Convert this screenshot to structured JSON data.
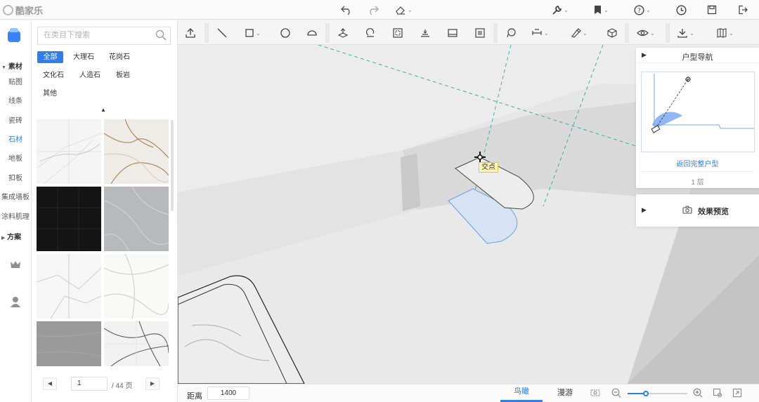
{
  "app": {
    "name": "酷家乐"
  },
  "rail": {
    "groups": {
      "materials": "素材",
      "solutions": "方案"
    },
    "items": [
      {
        "label": "贴图",
        "active": false
      },
      {
        "label": "线条",
        "active": false
      },
      {
        "label": "瓷砖",
        "active": false
      },
      {
        "label": "石材",
        "active": true
      },
      {
        "label": "地板",
        "active": false
      },
      {
        "label": "扣板",
        "active": false
      },
      {
        "label": "集成墙板",
        "active": false
      },
      {
        "label": "涂料肌理",
        "active": false
      }
    ],
    "icons": [
      "home-icon",
      "crown-icon",
      "user-icon"
    ]
  },
  "panel": {
    "search_placeholder": "在类目下搜索",
    "chips": [
      {
        "label": "全部",
        "active": true
      },
      {
        "label": "大理石",
        "active": false
      },
      {
        "label": "花岗石",
        "active": false
      },
      {
        "label": "文化石",
        "active": false
      },
      {
        "label": "人造石",
        "active": false
      },
      {
        "label": "板岩",
        "active": false
      },
      {
        "label": "其他",
        "active": false
      }
    ],
    "thumbnails": [
      "white-marble-grey-veins",
      "beige-marble-gold-veins",
      "black-marble",
      "grey-marble",
      "white-marble-grey-veins",
      "white-marble-soft-veins",
      "grey-stone",
      "white-marble-dark-veins"
    ],
    "pager": {
      "current": "1",
      "total": "/ 44 页"
    }
  },
  "toolbar_icons": [
    "undo-icon",
    "redo-icon",
    "eraser-icon",
    "wrench-icon",
    "bookmark-icon",
    "help-icon",
    "history-icon",
    "save-icon",
    "exit-icon"
  ],
  "drawing_tools": [
    "upload-icon",
    "line-tool-icon",
    "rectangle-tool-icon",
    "circle-tool-icon",
    "arc-tool-icon",
    "push-pull-icon",
    "rotate-icon",
    "offset-icon",
    "align-icon",
    "section-icon",
    "frame-icon",
    "lasso-icon",
    "dimension-icon",
    "brush-icon",
    "cube-icon",
    "eye-icon",
    "download-icon",
    "book-icon"
  ],
  "viewport": {
    "tooltip": "交点"
  },
  "navigator": {
    "title": "户型导航",
    "scale": "20",
    "link": "返回完整户型",
    "floor": "1 层"
  },
  "preview": {
    "title": "效果预览"
  },
  "bottom": {
    "distance_label": "距离",
    "distance_value": "1400",
    "tabs": [
      {
        "label": "鸟瞰",
        "active": true
      },
      {
        "label": "漫游",
        "active": false
      }
    ],
    "zoom_level": 0.3
  },
  "colors": {
    "accent": "#2f7fe7",
    "tooltip_bg": "#fff6b8"
  }
}
